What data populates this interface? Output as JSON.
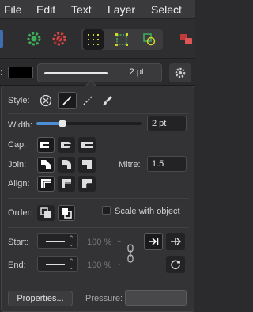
{
  "menubar": {
    "items": [
      "File",
      "Edit",
      "Text",
      "Layer",
      "Select"
    ]
  },
  "context_bar": {
    "stroke_width": "2 pt"
  },
  "stroke_panel": {
    "style_label": "Style:",
    "width_label": "Width:",
    "width_value": "2 pt",
    "width_slider_fraction": 0.25,
    "cap_label": "Cap:",
    "join_label": "Join:",
    "mitre_label": "Mitre:",
    "mitre_value": "1.5",
    "align_label": "Align:",
    "order_label": "Order:",
    "scale_with_object_label": "Scale with object",
    "start_label": "Start:",
    "start_scale": "100 %",
    "end_label": "End:",
    "end_scale": "100 %",
    "properties_button": "Properties...",
    "pressure_label": "Pressure:"
  },
  "colors": {
    "accent": "#4d8fd6",
    "green_icon": "#3fae5a",
    "red_icon": "#d24a4a",
    "yellow_icon": "#d6d62a"
  }
}
